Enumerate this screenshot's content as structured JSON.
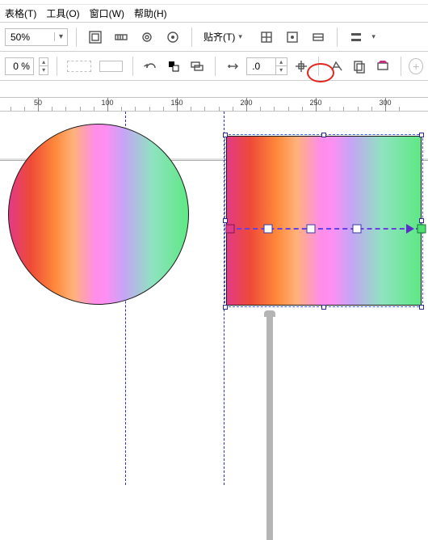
{
  "menu": {
    "table": "表格(T)",
    "tools": "工具(O)",
    "window": "窗口(W)",
    "help": "帮助(H)"
  },
  "toolbar1": {
    "zoom_value": "50%",
    "snap_label": "贴齐(T)"
  },
  "toolbar2": {
    "pct_suffix": "%",
    "pct_value": "0",
    "offset_value": ".0"
  },
  "ruler": {
    "majors": [
      50,
      100,
      150,
      200,
      250,
      300
    ]
  },
  "accent_highlight": "#e2261f"
}
